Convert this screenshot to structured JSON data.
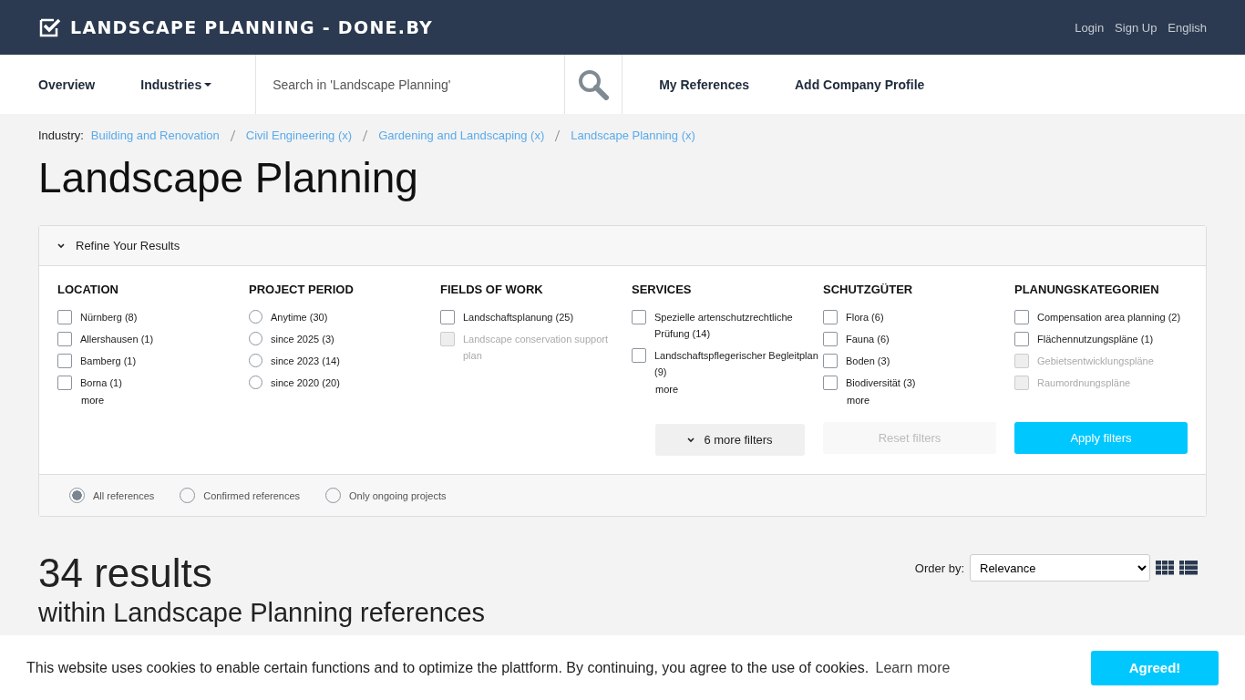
{
  "header": {
    "brand": "LANDSCAPE PLANNING - DONE.BY",
    "links": [
      "Login",
      "Sign Up",
      "English"
    ]
  },
  "nav": {
    "items": [
      {
        "label": "Overview",
        "dropdown": false
      },
      {
        "label": "Industries",
        "dropdown": true
      }
    ],
    "search": {
      "placeholder": "Search in 'Landscape Planning'"
    },
    "links": [
      "My References",
      "Add Company Profile"
    ]
  },
  "breadcrumb": {
    "label": "Industry:",
    "items": [
      "Building and Renovation",
      "Civil Engineering (x)",
      "Gardening and Landscaping (x)",
      "Landscape Planning (x)"
    ]
  },
  "title": "Landscape Planning",
  "refine": {
    "title": "Refine Your Results",
    "expanded": true,
    "columns": [
      {
        "title": "LOCATION",
        "kind": "checkbox",
        "more": "more",
        "items": [
          {
            "label": "Nürnberg (8)",
            "checked": false,
            "disabled": false
          },
          {
            "label": "Allershausen (1)",
            "checked": false,
            "disabled": false
          },
          {
            "label": "Bamberg (1)",
            "checked": false,
            "disabled": false
          },
          {
            "label": "Borna (1)",
            "checked": false,
            "disabled": false
          }
        ]
      },
      {
        "title": "PROJECT PERIOD",
        "kind": "radio",
        "items": [
          {
            "label": "Anytime (30)",
            "selected": false,
            "disabled": false
          },
          {
            "label": "since 2025 (3)",
            "selected": false,
            "disabled": false
          },
          {
            "label": "since 2023 (14)",
            "selected": false,
            "disabled": false
          },
          {
            "label": "since 2020 (20)",
            "selected": false,
            "disabled": false
          }
        ]
      },
      {
        "title": "FIELDS OF WORK",
        "kind": "checkbox",
        "items": [
          {
            "label": "Landschaftsplanung (25)",
            "checked": false,
            "disabled": false
          },
          {
            "label": "Landscape conservation support plan",
            "checked": false,
            "disabled": true
          }
        ]
      },
      {
        "title": "SERVICES",
        "kind": "checkbox",
        "more": "more",
        "items": [
          {
            "label": "Spezielle artenschutzrechtliche Prüfung (14)",
            "checked": false,
            "disabled": false
          },
          {
            "label": "Landschaftspflegerischer Begleitplan (9)",
            "checked": false,
            "disabled": false
          }
        ]
      },
      {
        "title": "SCHUTZGÜTER",
        "kind": "checkbox",
        "more": "more",
        "items": [
          {
            "label": "Flora (6)",
            "checked": false,
            "disabled": false
          },
          {
            "label": "Fauna (6)",
            "checked": false,
            "disabled": false
          },
          {
            "label": "Boden (3)",
            "checked": false,
            "disabled": false
          },
          {
            "label": "Biodiversität (3)",
            "checked": false,
            "disabled": false
          }
        ]
      },
      {
        "title": "PLANUNGSKATEGORIEN",
        "kind": "checkbox",
        "items": [
          {
            "label": "Compensation area planning (2)",
            "checked": false,
            "disabled": false
          },
          {
            "label": "Flächennutzungspläne (1)",
            "checked": false,
            "disabled": false
          },
          {
            "label": "Gebietsentwicklungspläne",
            "checked": false,
            "disabled": true
          },
          {
            "label": "Raumordnungspläne",
            "checked": false,
            "disabled": true
          }
        ]
      }
    ],
    "buttons": [
      {
        "label": "6 more filters",
        "kind": "more"
      },
      {
        "label": "Reset filters",
        "kind": "reset",
        "disabled": true
      },
      {
        "label": "Apply filters",
        "kind": "apply",
        "disabled": false
      }
    ],
    "scope": [
      {
        "label": "All references",
        "selected": true
      },
      {
        "label": "Confirmed references",
        "selected": false
      },
      {
        "label": "Only ongoing projects",
        "selected": false
      }
    ]
  },
  "results": {
    "count": "34 results",
    "subtitle": "within Landscape Planning references",
    "order_label": "Order by:",
    "order_value": "Relevance"
  },
  "cookie": {
    "text": "This website uses cookies to enable certain functions and to optimize the plattform. By continuing, you agree to the use of cookies.",
    "link": "Learn more",
    "button": "Agreed!"
  }
}
